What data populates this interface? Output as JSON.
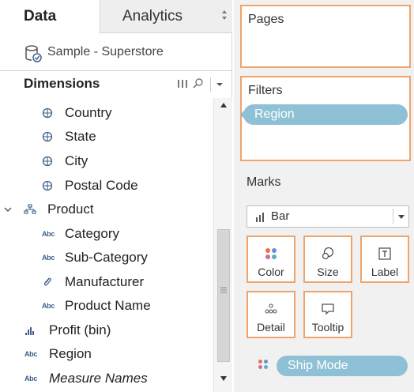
{
  "tabs": {
    "data": "Data",
    "analytics": "Analytics"
  },
  "datasource": {
    "name": "Sample - Superstore"
  },
  "dimensions": {
    "title": "Dimensions",
    "items": [
      {
        "label": "Country",
        "icon": "globe-icon",
        "italic": false
      },
      {
        "label": "State",
        "icon": "globe-icon",
        "italic": false
      },
      {
        "label": "City",
        "icon": "globe-icon",
        "italic": false
      },
      {
        "label": "Postal Code",
        "icon": "globe-icon",
        "italic": false
      },
      {
        "label": "Product",
        "icon": "hierarchy-icon",
        "italic": false
      },
      {
        "label": "Category",
        "icon": "abc-icon",
        "italic": false
      },
      {
        "label": "Sub-Category",
        "icon": "abc-icon",
        "italic": false
      },
      {
        "label": "Manufacturer",
        "icon": "paperclip-icon",
        "italic": false
      },
      {
        "label": "Product Name",
        "icon": "abc-icon",
        "italic": false
      },
      {
        "label": "Profit (bin)",
        "icon": "bin-icon",
        "italic": false
      },
      {
        "label": "Region",
        "icon": "abc-icon",
        "italic": false
      },
      {
        "label": "Measure Names",
        "icon": "abc-icon",
        "italic": true
      }
    ]
  },
  "shelves": {
    "pages": "Pages",
    "filters": "Filters",
    "filter_pill": "Region"
  },
  "marks": {
    "title": "Marks",
    "type": "Bar",
    "buttons": {
      "color": "Color",
      "size": "Size",
      "label": "Label",
      "detail": "Detail",
      "tooltip": "Tooltip"
    },
    "color_field": "Ship Mode"
  },
  "colors": {
    "accent_border": "#f0a36a",
    "pill": "#8fc1d6",
    "icon_blue": "#3e6089"
  }
}
